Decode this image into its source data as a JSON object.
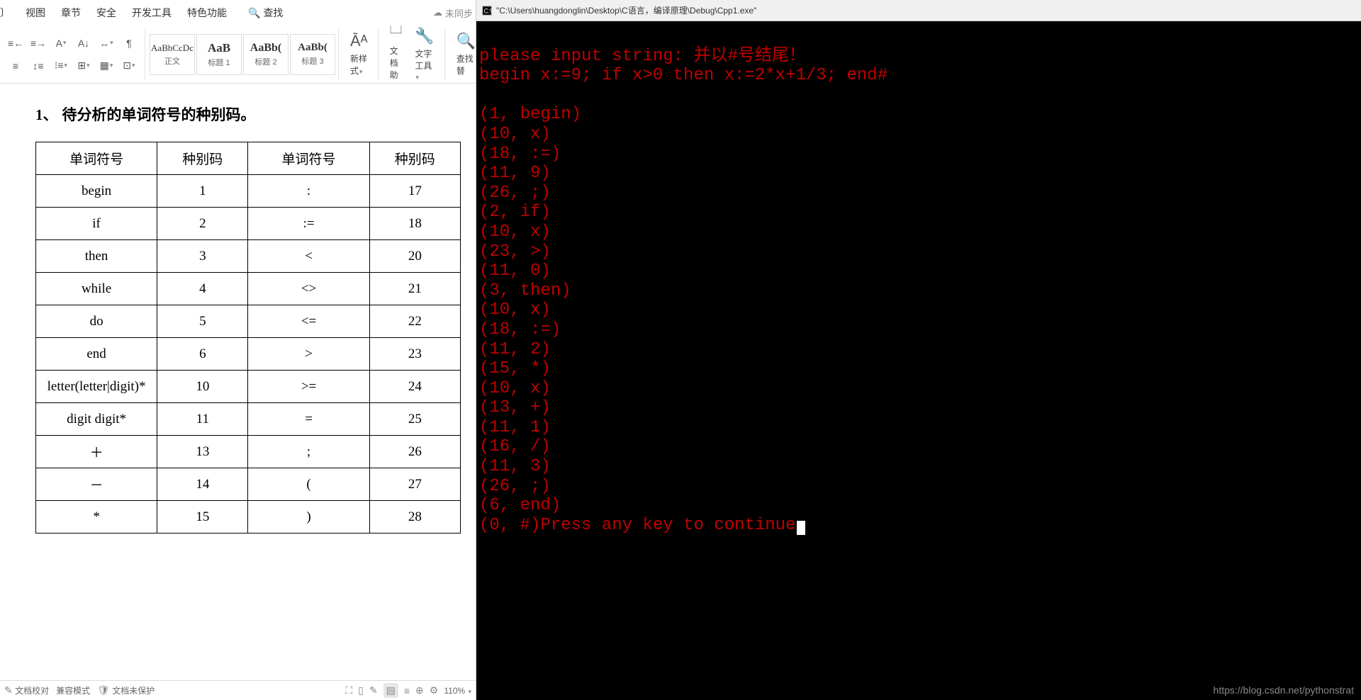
{
  "left": {
    "menu": [
      "视图",
      "章节",
      "安全",
      "开发工具",
      "特色功能"
    ],
    "search_label": "查找",
    "sync_label": "未同步",
    "styles": [
      {
        "preview": "AaBbCcDc",
        "label": "正文"
      },
      {
        "preview": "AaB",
        "label": "标题 1"
      },
      {
        "preview": "AaBb(",
        "label": "标题 2"
      },
      {
        "preview": "AaBb(",
        "label": "标题 3"
      }
    ],
    "toolbar_buttons": {
      "new_style": "新样式",
      "doc_helper": "文档助手",
      "text_tools": "文字工具",
      "find_replace": "查找替"
    },
    "heading_num": "1、",
    "heading_text": "待分析的单词符号的种别码。",
    "table": {
      "headers": [
        "单词符号",
        "种别码",
        "单词符号",
        "种别码"
      ],
      "rows": [
        [
          "begin",
          "1",
          ":",
          "17"
        ],
        [
          "if",
          "2",
          ":=",
          "18"
        ],
        [
          "then",
          "3",
          "<",
          "20"
        ],
        [
          "while",
          "4",
          "<>",
          "21"
        ],
        [
          "do",
          "5",
          "<=",
          "22"
        ],
        [
          "end",
          "6",
          ">",
          "23"
        ],
        [
          "letter(letter|digit)*",
          "10",
          ">=",
          "24"
        ],
        [
          "digit digit*",
          "11",
          "=",
          "25"
        ],
        [
          "＋",
          "13",
          ";",
          "26"
        ],
        [
          "－",
          "14",
          "(",
          "27"
        ],
        [
          "*",
          "15",
          ")",
          "28"
        ]
      ]
    },
    "status": {
      "proof": "文档校对",
      "compat": "兼容模式",
      "protect": "文档未保护",
      "zoom": "110%"
    }
  },
  "right": {
    "title": "\"C:\\Users\\huangdonglin\\Desktop\\C语言，编译原理\\Debug\\Cpp1.exe\"",
    "prompt": "please input string: 并以#号结尾！",
    "input_line": "begin x:=9; if x>0 then x:=2*x+1/3; end#",
    "tokens": [
      "(1, begin)",
      "(10, x)",
      "(18, :=)",
      "(11, 9)",
      "(26, ;)",
      "(2, if)",
      "(10, x)",
      "(23, >)",
      "(11, 0)",
      "(3, then)",
      "(10, x)",
      "(18, :=)",
      "(11, 2)",
      "(15, *)",
      "(10, x)",
      "(13, +)",
      "(11, 1)",
      "(16, /)",
      "(11, 3)",
      "(26, ;)",
      "(6, end)"
    ],
    "final": "(0, #)Press any key to continue",
    "watermark": "https://blog.csdn.net/pythonstrat"
  }
}
